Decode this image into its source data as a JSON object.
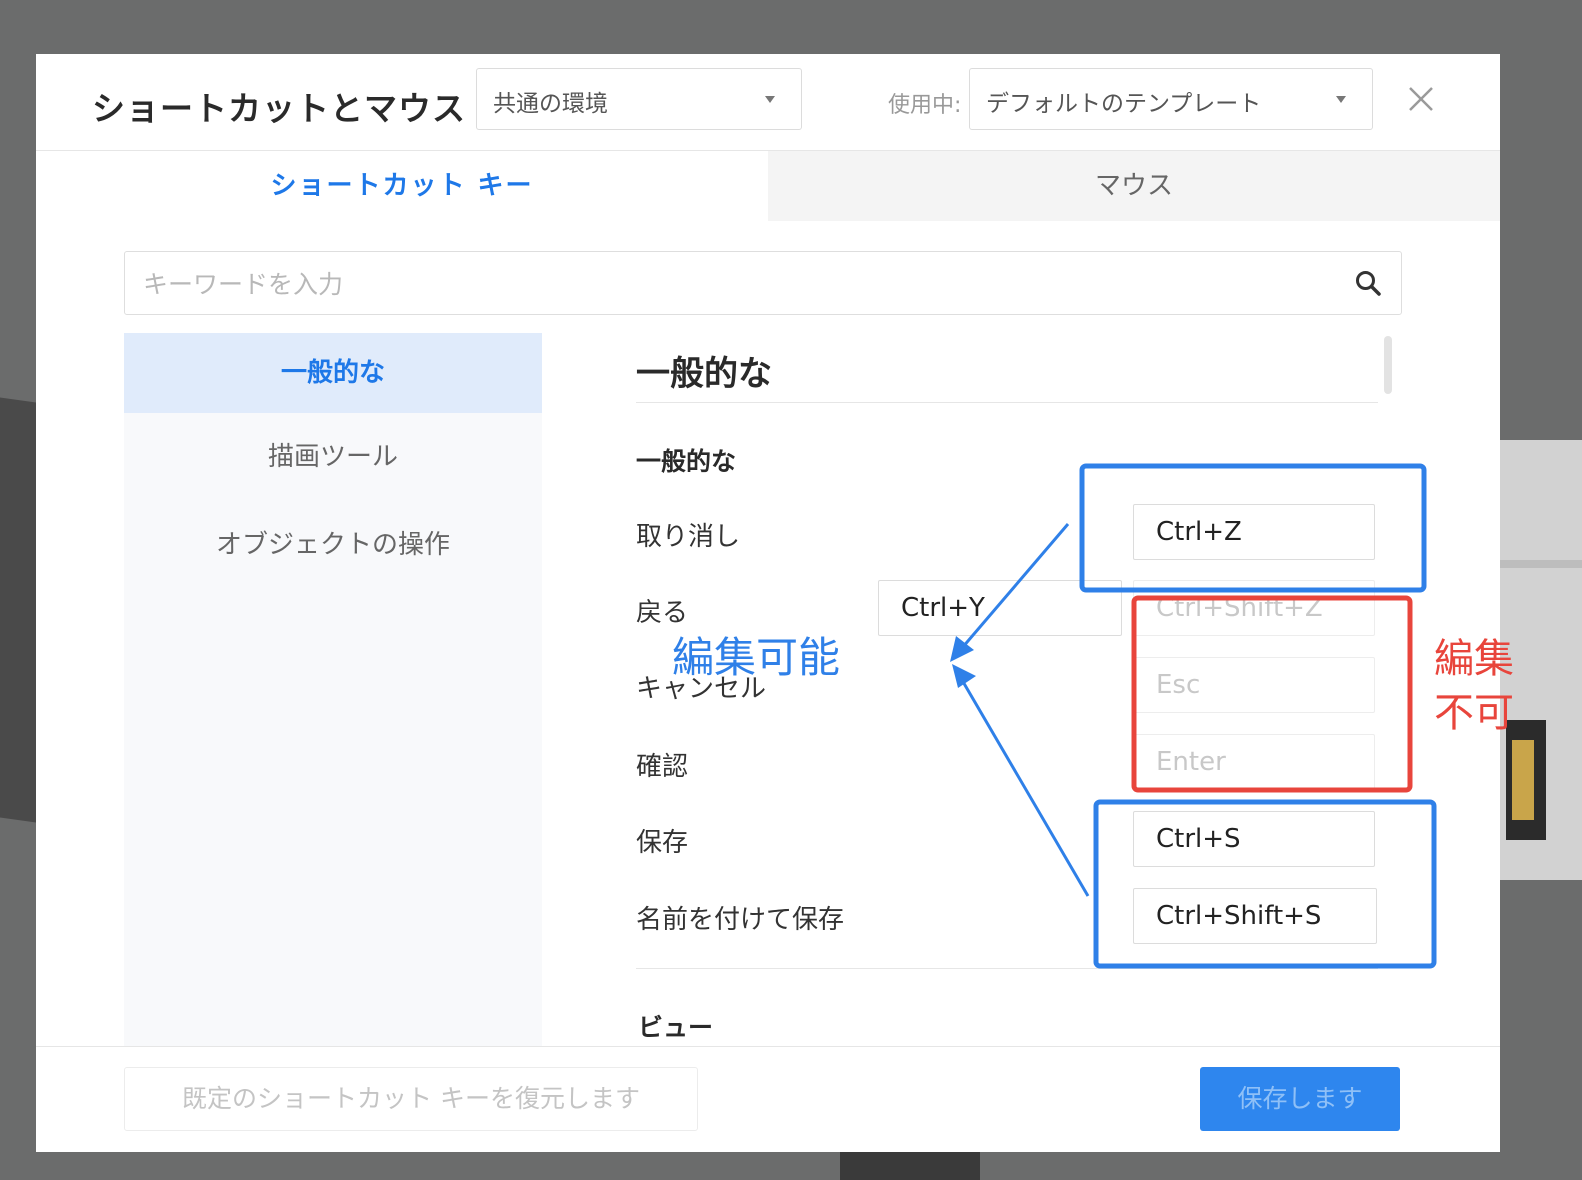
{
  "header": {
    "title": "ショートカットとマウス",
    "environment_select": "共通の環境",
    "using_label": "使用中:",
    "template_select": "デフォルトのテンプレート"
  },
  "tabs": [
    {
      "label": "ショートカット キー",
      "active": true
    },
    {
      "label": "マウス",
      "active": false
    }
  ],
  "search": {
    "placeholder": "キーワードを入力"
  },
  "sidebar": {
    "items": [
      {
        "label": "一般的な",
        "active": true
      },
      {
        "label": "描画ツール",
        "active": false
      },
      {
        "label": "オブジェクトの操作",
        "active": false
      }
    ]
  },
  "content": {
    "section_title": "一般的な",
    "group_title": "一般的な",
    "rows": [
      {
        "label": "取り消し",
        "keys": [
          "Ctrl+Z"
        ]
      },
      {
        "label": "戻る",
        "keys": [
          "Ctrl+Y",
          "Ctrl+Shift+Z"
        ]
      },
      {
        "label": "キャンセル",
        "keys": [
          "Esc"
        ]
      },
      {
        "label": "確認",
        "keys": [
          "Enter"
        ]
      },
      {
        "label": "保存",
        "keys": [
          "Ctrl+S"
        ]
      },
      {
        "label": "名前を付けて保存",
        "keys": [
          "Ctrl+Shift+S"
        ]
      }
    ],
    "next_group_title": "ビュー"
  },
  "footer": {
    "restore_label": "既定のショートカット キーを復元します",
    "save_label": "保存します"
  },
  "annotations": {
    "editable": "編集可能",
    "not_editable_line1": "編集",
    "not_editable_line2": "不可"
  },
  "colors": {
    "accent": "#1e78e8",
    "annotation_blue": "#2f80e8",
    "annotation_red": "#e8453c"
  }
}
